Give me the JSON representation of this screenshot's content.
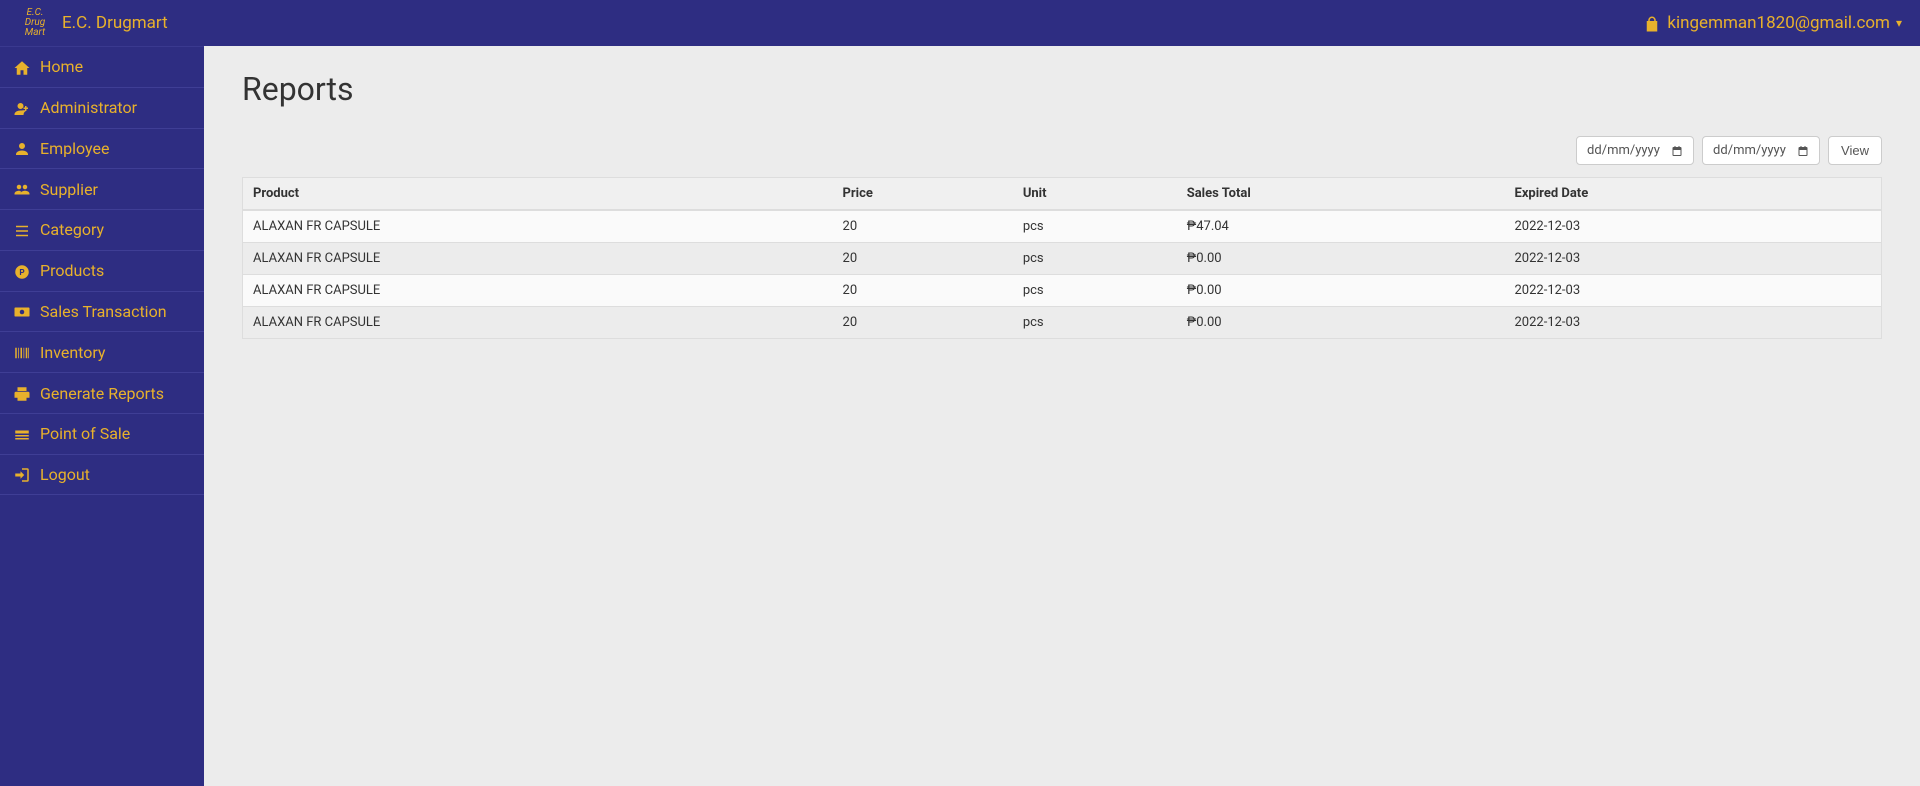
{
  "brand": {
    "title": "E.C. Drugmart",
    "logo_text": "E.C. Drug Mart"
  },
  "user": {
    "email": "kingemman1820@gmail.com"
  },
  "sidebar": {
    "items": [
      {
        "label": "Home",
        "icon": "home-icon"
      },
      {
        "label": "Administrator",
        "icon": "user-plus-icon"
      },
      {
        "label": "Employee",
        "icon": "user-icon"
      },
      {
        "label": "Supplier",
        "icon": "users-icon"
      },
      {
        "label": "Category",
        "icon": "list-icon"
      },
      {
        "label": "Products",
        "icon": "product-icon"
      },
      {
        "label": "Sales Transaction",
        "icon": "money-icon"
      },
      {
        "label": "Inventory",
        "icon": "barcode-icon"
      },
      {
        "label": "Generate Reports",
        "icon": "print-icon"
      },
      {
        "label": "Point of Sale",
        "icon": "pos-icon"
      },
      {
        "label": "Logout",
        "icon": "logout-icon"
      }
    ]
  },
  "page": {
    "title": "Reports"
  },
  "filters": {
    "date_from_placeholder": "dd/mm/yyyy",
    "date_to_placeholder": "dd/mm/yyyy",
    "view_label": "View"
  },
  "table": {
    "headers": {
      "product": "Product",
      "price": "Price",
      "unit": "Unit",
      "sales_total": "Sales Total",
      "expired_date": "Expired Date"
    },
    "rows": [
      {
        "product": "ALAXAN FR CAPSULE",
        "price": "20",
        "unit": "pcs",
        "sales_total": "₱47.04",
        "expired_date": "2022-12-03"
      },
      {
        "product": "ALAXAN FR CAPSULE",
        "price": "20",
        "unit": "pcs",
        "sales_total": "₱0.00",
        "expired_date": "2022-12-03"
      },
      {
        "product": "ALAXAN FR CAPSULE",
        "price": "20",
        "unit": "pcs",
        "sales_total": "₱0.00",
        "expired_date": "2022-12-03"
      },
      {
        "product": "ALAXAN FR CAPSULE",
        "price": "20",
        "unit": "pcs",
        "sales_total": "₱0.00",
        "expired_date": "2022-12-03"
      }
    ]
  }
}
